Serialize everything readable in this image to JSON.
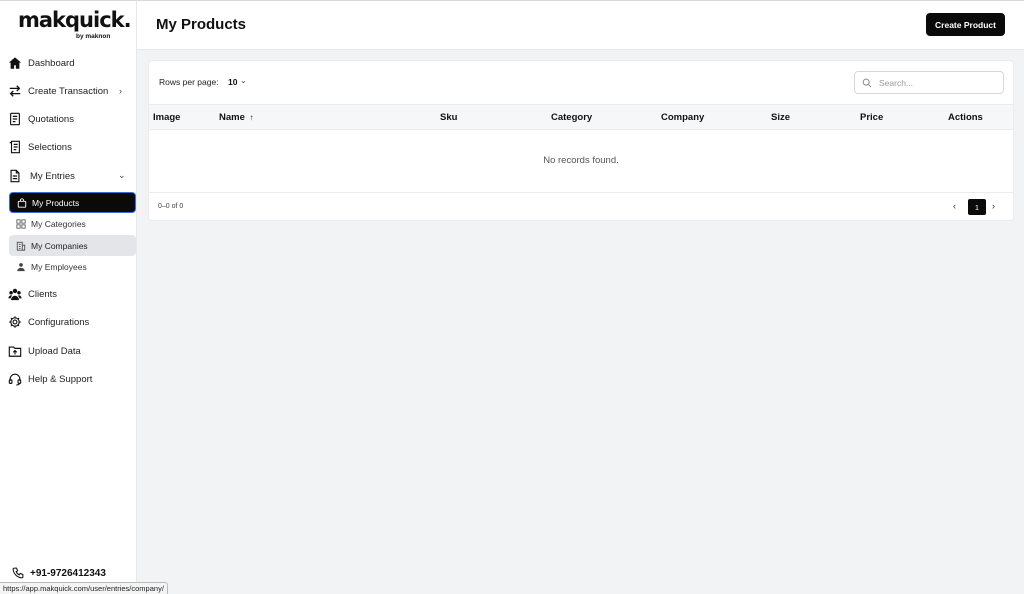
{
  "brand": {
    "name": "makquick.",
    "tagline": "by maknon"
  },
  "sidebar": {
    "items": [
      {
        "label": "Dashboard",
        "icon": "home-icon"
      },
      {
        "label": "Create Transaction",
        "icon": "transfer-icon"
      },
      {
        "label": "Quotations",
        "icon": "quotation-icon"
      },
      {
        "label": "Selections",
        "icon": "selection-icon"
      },
      {
        "label": "My Entries",
        "icon": "file-icon"
      },
      {
        "label": "Clients",
        "icon": "clients-icon"
      },
      {
        "label": "Configurations",
        "icon": "gear-icon"
      },
      {
        "label": "Upload Data",
        "icon": "upload-folder-icon"
      },
      {
        "label": "Help & Support",
        "icon": "headset-icon"
      }
    ],
    "entries": [
      {
        "label": "My Products",
        "icon": "bag-icon",
        "state": "active"
      },
      {
        "label": "My Categories",
        "icon": "grid-icon",
        "state": "normal"
      },
      {
        "label": "My Companies",
        "icon": "building-icon",
        "state": "hover"
      },
      {
        "label": "My Employees",
        "icon": "user-icon",
        "state": "normal"
      }
    ],
    "phone": "+91-9726412343"
  },
  "status_url": "https://app.makquick.com/user/entries/company/",
  "header": {
    "title": "My Products",
    "create_label": "Create Product"
  },
  "table": {
    "rows_per_page_label": "Rows per page:",
    "rows_per_page_value": "10",
    "search_placeholder": "Search...",
    "columns": [
      "Image",
      "Name",
      "Sku",
      "Category",
      "Company",
      "Size",
      "Price",
      "Actions"
    ],
    "sort_indicator": "↑",
    "empty_text": "No records found.",
    "range_text": "0–0 of 0",
    "current_page": "1"
  },
  "colors": {
    "accent": "#0a0a0a",
    "active_border": "#3a6fd8",
    "background": "#f2f3f5"
  }
}
